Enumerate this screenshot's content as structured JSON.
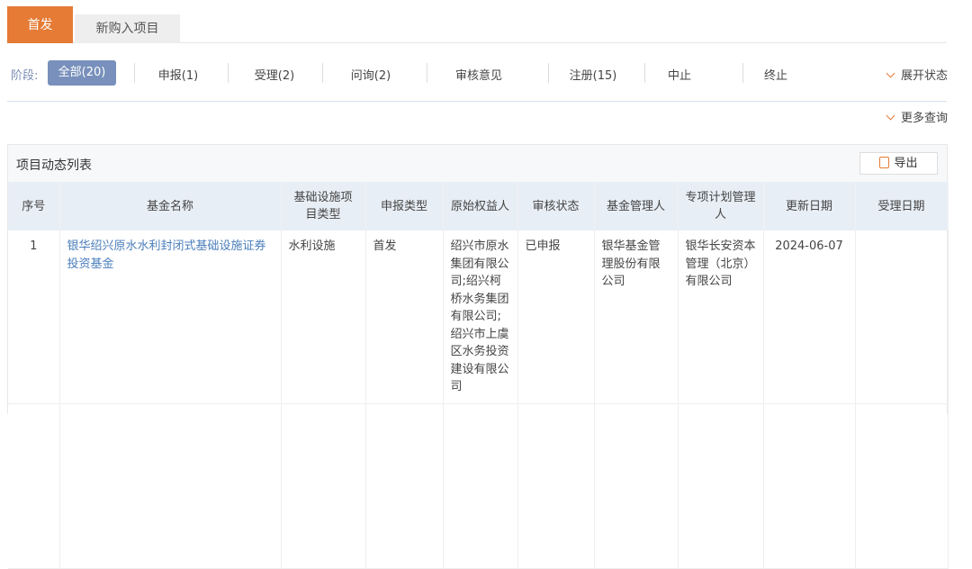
{
  "tabs": [
    "首发",
    "新购入项目"
  ],
  "stage": {
    "label": "阶段:",
    "all": "全部(20)",
    "items": [
      "申报(1)",
      "受理(2)",
      "问询(2)",
      "审核意见",
      "注册(15)",
      "中止",
      "终止"
    ],
    "expand": "展开状态",
    "more": "更多查询"
  },
  "panel": {
    "title": "项目动态列表",
    "export": "导出"
  },
  "table": {
    "headers": [
      "序号",
      "基金名称",
      "基础设施项目类型",
      "申报类型",
      "原始权益人",
      "审核状态",
      "基金管理人",
      "专项计划管理人",
      "更新日期",
      "受理日期"
    ],
    "rows": [
      [
        "1",
        "银华绍兴原水水利封闭式基础设施证券投资基金",
        "水利设施",
        "首发",
        "绍兴市原水集团有限公司;绍兴柯桥水务集团有限公司;绍兴市上虞区水务投资建设有限公司",
        "已申报",
        "银华基金管理股份有限公司",
        "银华长安资本管理（北京）有限公司",
        "2024-06-07",
        ""
      ]
    ]
  },
  "colors": {
    "accent": "#E57B35",
    "active": "#7890BB"
  }
}
